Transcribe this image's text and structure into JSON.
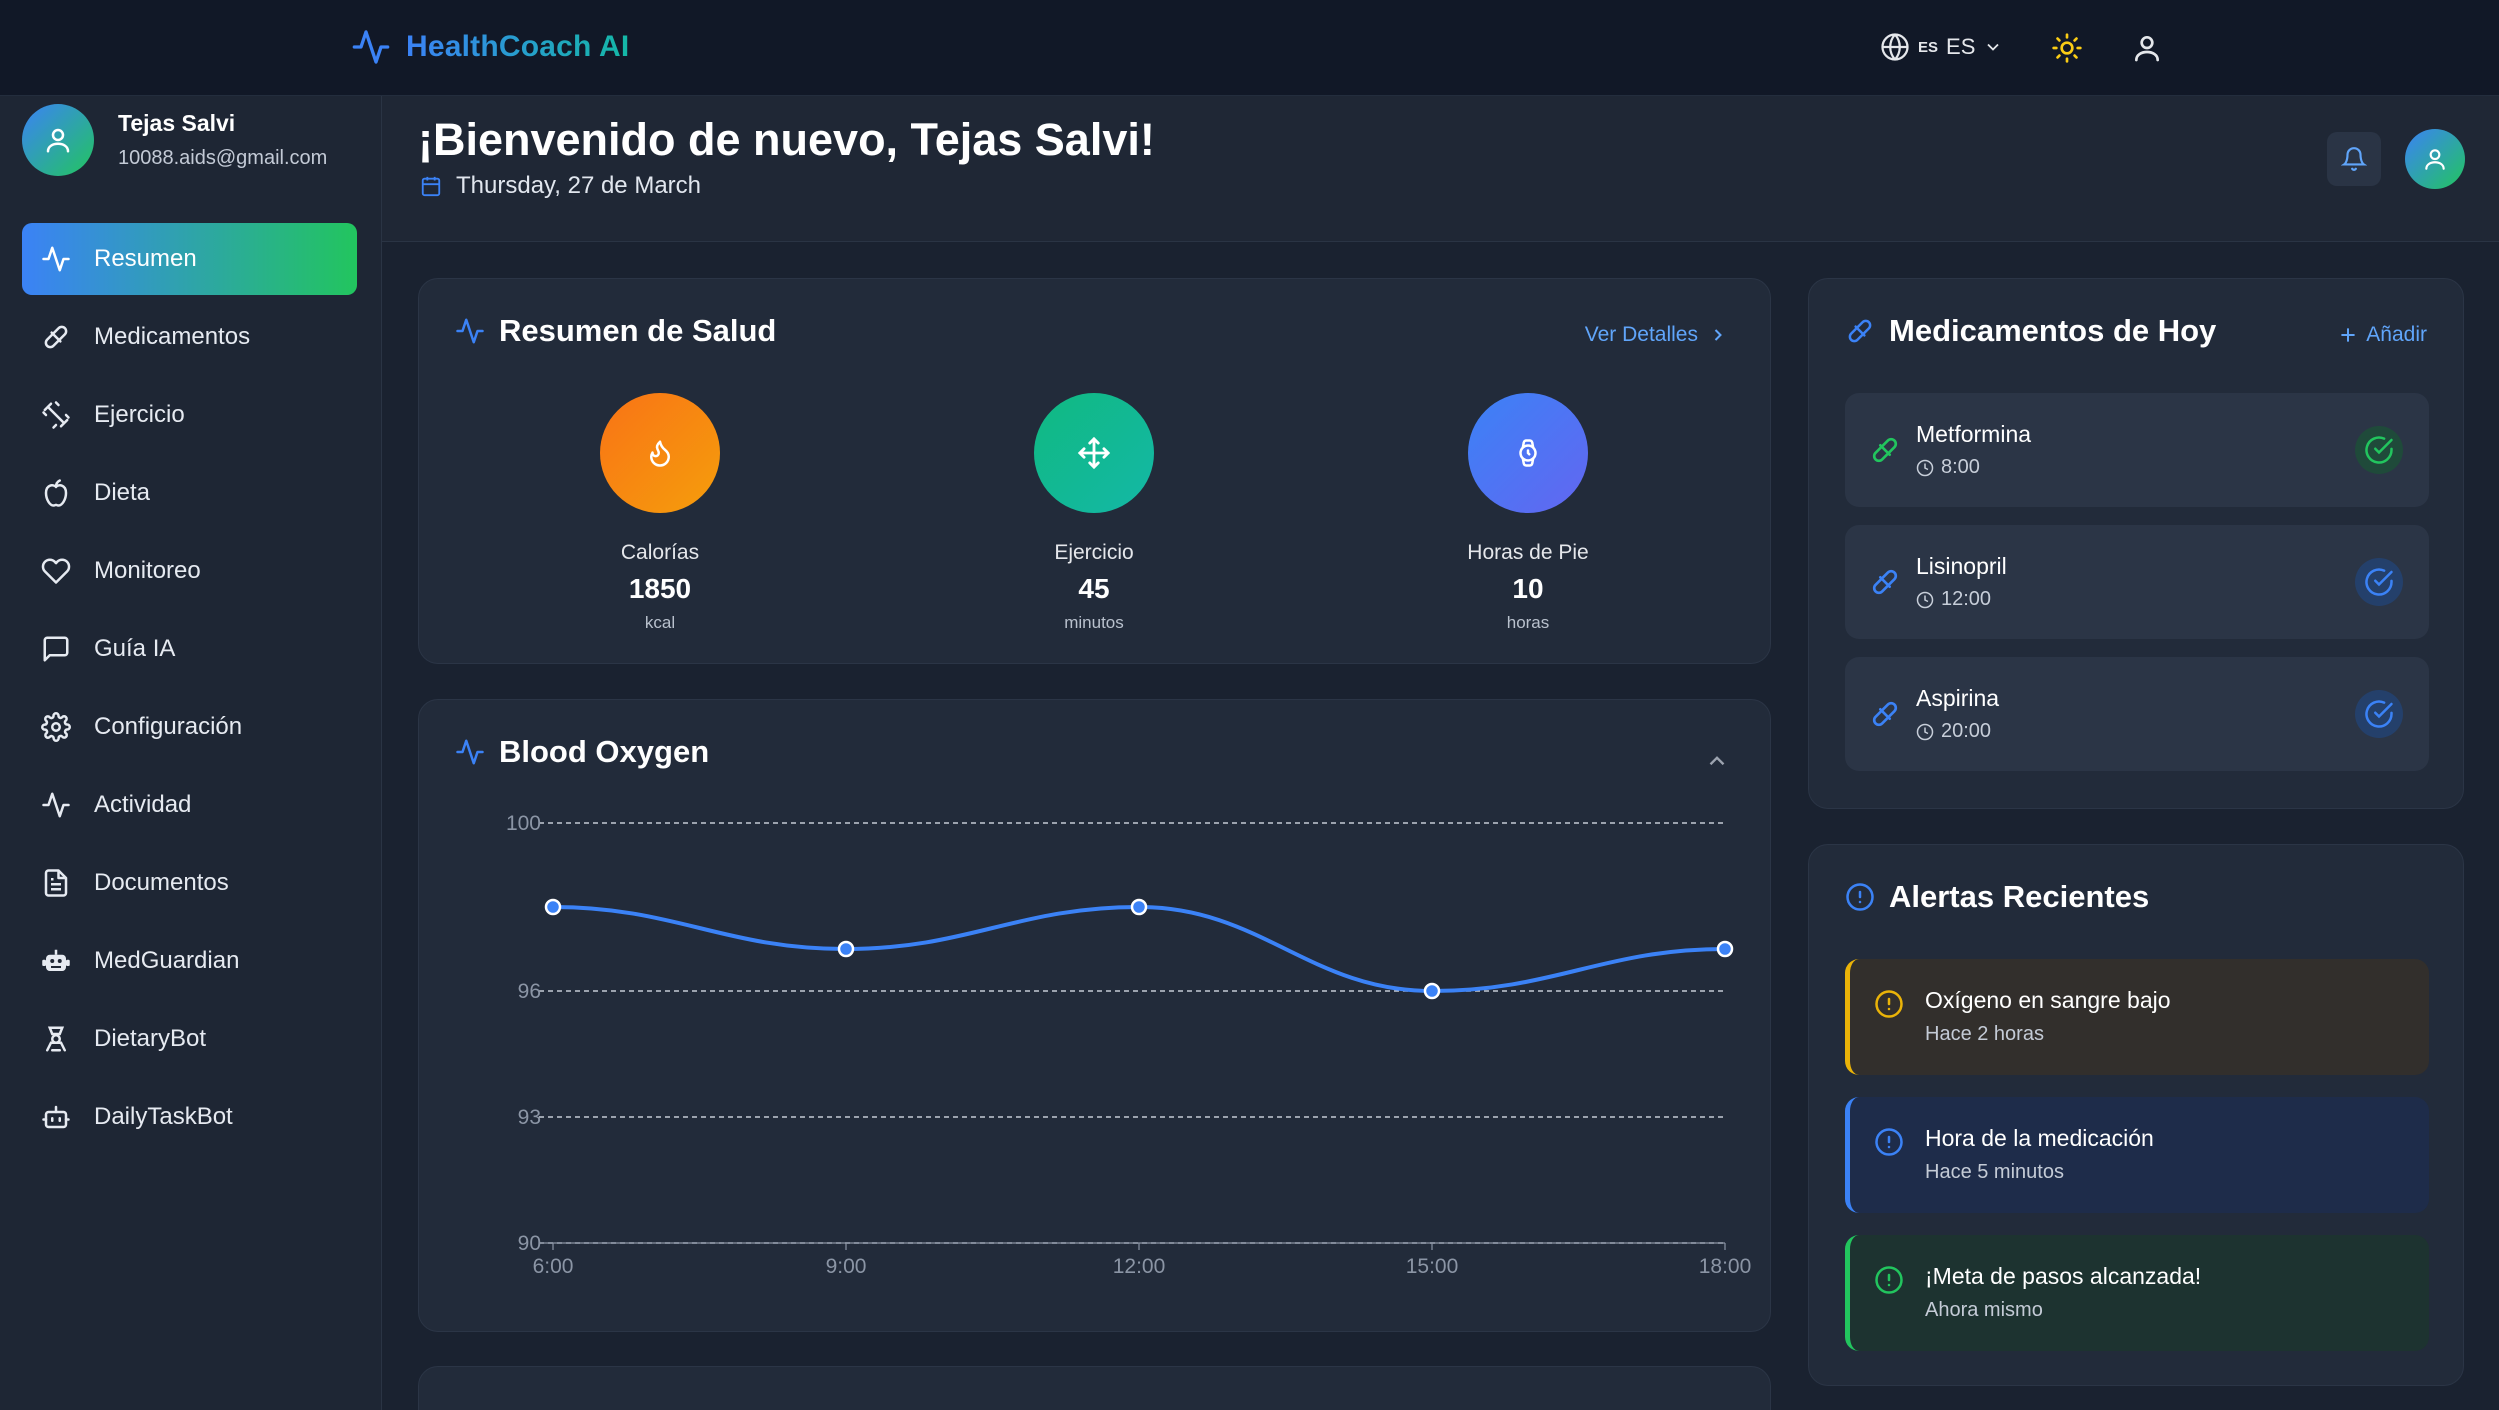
{
  "app": {
    "title": "HealthCoach AI"
  },
  "header": {
    "language_label": "ES",
    "language_flag": "ES"
  },
  "user": {
    "name": "Tejas Salvi",
    "email": "10088.aids@gmail.com"
  },
  "sidebar": {
    "items": [
      {
        "label": "Resumen",
        "icon": "activity-icon",
        "active": true
      },
      {
        "label": "Medicamentos",
        "icon": "pill-icon"
      },
      {
        "label": "Ejercicio",
        "icon": "dumbbell-icon"
      },
      {
        "label": "Dieta",
        "icon": "apple-icon"
      },
      {
        "label": "Monitoreo",
        "icon": "heart-icon"
      },
      {
        "label": "Guía IA",
        "icon": "message-icon"
      },
      {
        "label": "Configuración",
        "icon": "gear-icon"
      },
      {
        "label": "Actividad",
        "icon": "activity-icon"
      },
      {
        "label": "Documentos",
        "icon": "document-icon"
      },
      {
        "label": "MedGuardian",
        "icon": "robot-icon"
      },
      {
        "label": "DietaryBot",
        "icon": "chef-icon"
      },
      {
        "label": "DailyTaskBot",
        "icon": "bot-icon"
      }
    ]
  },
  "page": {
    "welcome": "¡Bienvenido de nuevo, Tejas Salvi!",
    "date": "Thursday, 27 de March"
  },
  "summary": {
    "title": "Resumen de Salud",
    "details_label": "Ver Detalles",
    "metrics": [
      {
        "label": "Calorías",
        "value": "1850",
        "unit": "kcal",
        "icon": "flame-icon",
        "color_from": "#f97316",
        "color_to": "#f59e0b"
      },
      {
        "label": "Ejercicio",
        "value": "45",
        "unit": "minutos",
        "icon": "move-icon",
        "color_from": "#10b981",
        "color_to": "#14b8a6"
      },
      {
        "label": "Horas de Pie",
        "value": "10",
        "unit": "horas",
        "icon": "watch-icon",
        "color_from": "#3b82f6",
        "color_to": "#6366f1"
      }
    ]
  },
  "oxygen": {
    "title": "Blood Oxygen"
  },
  "chart_data": {
    "type": "line",
    "title": "Blood Oxygen",
    "x": [
      "6:00",
      "9:00",
      "12:00",
      "15:00",
      "18:00"
    ],
    "series": [
      {
        "values": [
          98,
          97,
          98,
          96,
          97
        ]
      }
    ],
    "y_ticks": [
      90,
      93,
      96,
      100
    ],
    "ylim": [
      90,
      100
    ],
    "grid": true,
    "line_color": "#3b82f6"
  },
  "medications": {
    "title": "Medicamentos de Hoy",
    "add_label": "Añadir",
    "items": [
      {
        "name": "Metformina",
        "time": "8:00",
        "taken": true,
        "color": "#22c55e"
      },
      {
        "name": "Lisinopril",
        "time": "12:00",
        "taken": false,
        "color": "#3b82f6"
      },
      {
        "name": "Aspirina",
        "time": "20:00",
        "taken": false,
        "color": "#3b82f6"
      }
    ]
  },
  "alerts": {
    "title": "Alertas Recientes",
    "items": [
      {
        "title": "Oxígeno en sangre bajo",
        "time": "Hace 2 horas",
        "color": "#eab308"
      },
      {
        "title": "Hora de la medicación",
        "time": "Hace 5 minutos",
        "color": "#3b82f6"
      },
      {
        "title": "¡Meta de pasos alcanzada!",
        "time": "Ahora mismo",
        "color": "#22c55e"
      }
    ]
  }
}
